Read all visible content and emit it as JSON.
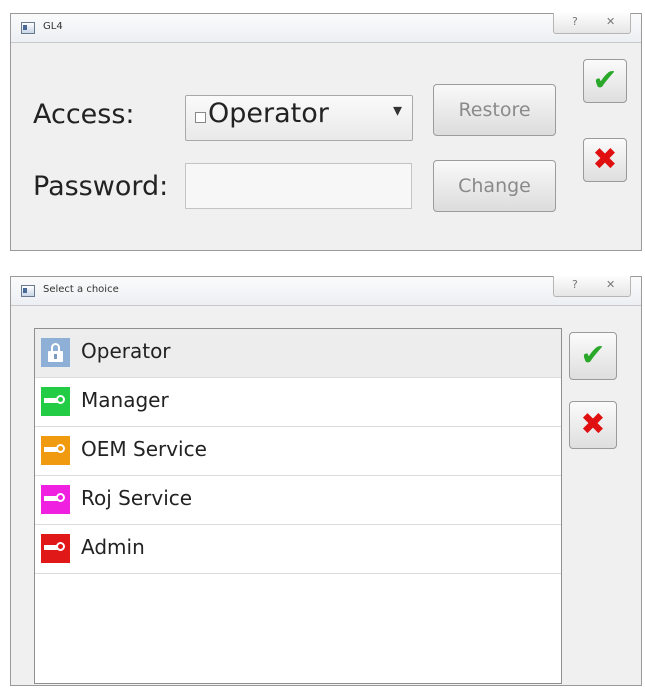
{
  "top_window": {
    "title": "GL4",
    "help_glyph": "?",
    "close_glyph": "✕",
    "access_label": "Access:",
    "access_value": "Operator",
    "combo_arrow": "▾",
    "password_label": "Password:",
    "password_value": "",
    "restore_label": "Restore",
    "change_label": "Change",
    "ok_glyph": "✔",
    "cancel_glyph": "✖"
  },
  "choice_window": {
    "title": "Select a choice",
    "help_glyph": "?",
    "close_glyph": "✕",
    "ok_glyph": "✔",
    "cancel_glyph": "✖",
    "items": [
      {
        "label": "Operator",
        "icon": "lock-icon",
        "color": "#8fb0d6",
        "selected": true
      },
      {
        "label": "Manager",
        "icon": "key-icon",
        "color": "#22cc44",
        "selected": false
      },
      {
        "label": "OEM Service",
        "icon": "key-icon",
        "color": "#f09a10",
        "selected": false
      },
      {
        "label": "Roj Service",
        "icon": "key-icon",
        "color": "#f020e0",
        "selected": false
      },
      {
        "label": "Admin",
        "icon": "key-icon",
        "color": "#e01818",
        "selected": false
      }
    ]
  }
}
